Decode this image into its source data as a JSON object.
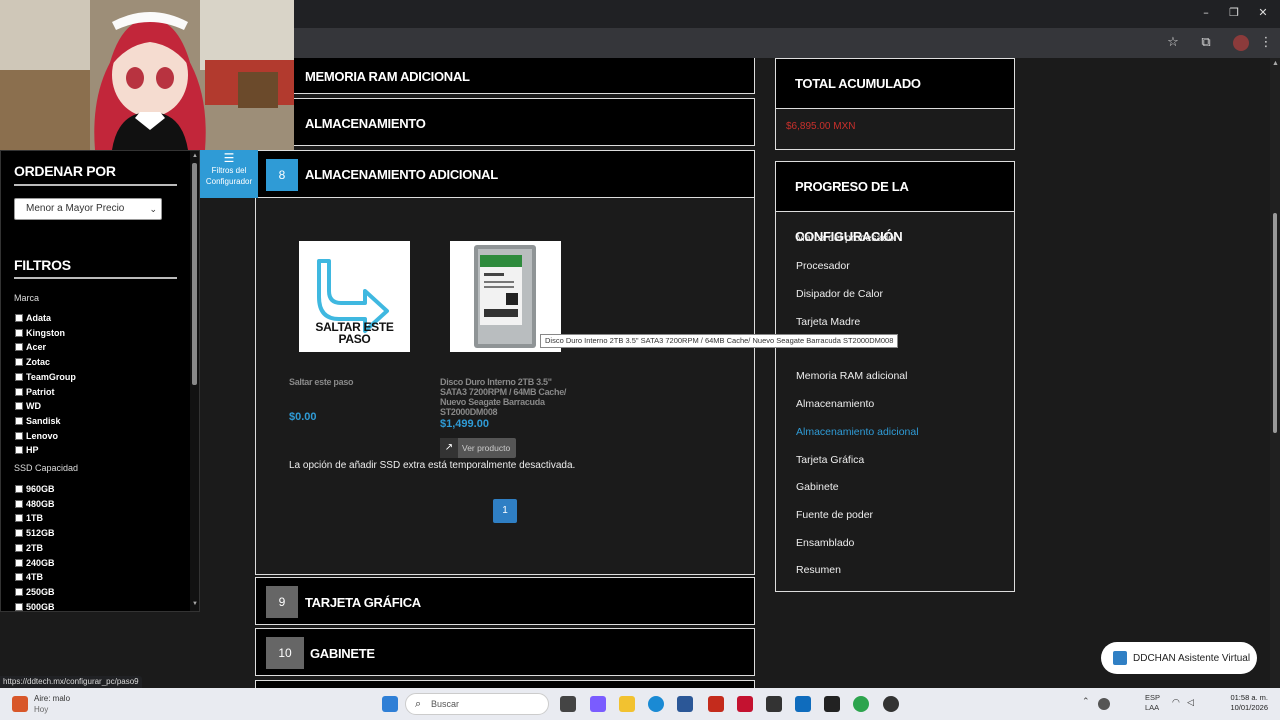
{
  "browser": {
    "status_url": "https://ddtech.mx/configurar_pc/paso9"
  },
  "filters_toggle": {
    "label_line1": "Filtros del",
    "label_line2": "Configurador"
  },
  "sidebar": {
    "sort_title": "ORDENAR POR",
    "sort_selected": "Menor a Mayor Precio",
    "filters_title": "FILTROS",
    "brand_label": "Marca",
    "brands": [
      "Adata",
      "Kingston",
      "Acer",
      "Zotac",
      "TeamGroup",
      "Patriot",
      "WD",
      "Sandisk",
      "Lenovo",
      "HP"
    ],
    "ssd_label": "SSD Capacidad",
    "capacities": [
      "960GB",
      "480GB",
      "1TB",
      "512GB",
      "2TB",
      "240GB",
      "4TB",
      "250GB",
      "500GB"
    ]
  },
  "steps": {
    "ram": {
      "title": "MEMORIA RAM ADICIONAL"
    },
    "storage": {
      "title": "ALMACENAMIENTO"
    },
    "extra_storage": {
      "number": "8",
      "title": "ALMACENAMIENTO ADICIONAL"
    },
    "gpu": {
      "number": "9",
      "title": "TARJETA GRÁFICA"
    },
    "case": {
      "number": "10",
      "title": "GABINETE"
    }
  },
  "products": [
    {
      "image_text": "SALTAR ESTE PASO",
      "name": "Saltar este paso",
      "price": "$0.00"
    },
    {
      "image_text": "",
      "name": "Disco Duro Interno 2TB 3.5\" SATA3 7200RPM / 64MB Cache/ Nuevo Seagate Barracuda ST2000DM008",
      "price": "$1,499.00",
      "button": "Ver producto"
    }
  ],
  "tooltip": "Disco Duro Interno 2TB 3.5\" SATA3 7200RPM / 64MB Cache/ Nuevo Seagate Barracuda ST2000DM008",
  "notice": "La opción de añadir SSD extra está temporalmente desactivada.",
  "pagination": {
    "current": "1"
  },
  "total": {
    "title": "TOTAL ACUMULADO",
    "value": "$6,895.00 MXN"
  },
  "progress": {
    "title": "PROGRESO DE LA CONFIGURACIÓN",
    "items": [
      "Marca del procesador",
      "Procesador",
      "Disipador de Calor",
      "Tarjeta Madre",
      "Memoria RAM adicional",
      "Almacenamiento",
      "Almacenamiento adicional",
      "Tarjeta Gráfica",
      "Gabinete",
      "Fuente de poder",
      "Ensamblado",
      "Resumen"
    ],
    "active_index": 6
  },
  "assistant": {
    "label": "DDCHAN Asistente Virtual"
  },
  "taskbar": {
    "weather_line1": "Aire: malo",
    "weather_line2": "Hoy",
    "search_placeholder": "Buscar",
    "lang_line1": "ESP",
    "lang_line2": "LAA",
    "time": "01:58 a. m.",
    "date": "10/01/2026"
  },
  "colors": {
    "accent": "#2f9bd6",
    "price_red": "#c9302c",
    "page_bg": "#1b1b1b"
  }
}
